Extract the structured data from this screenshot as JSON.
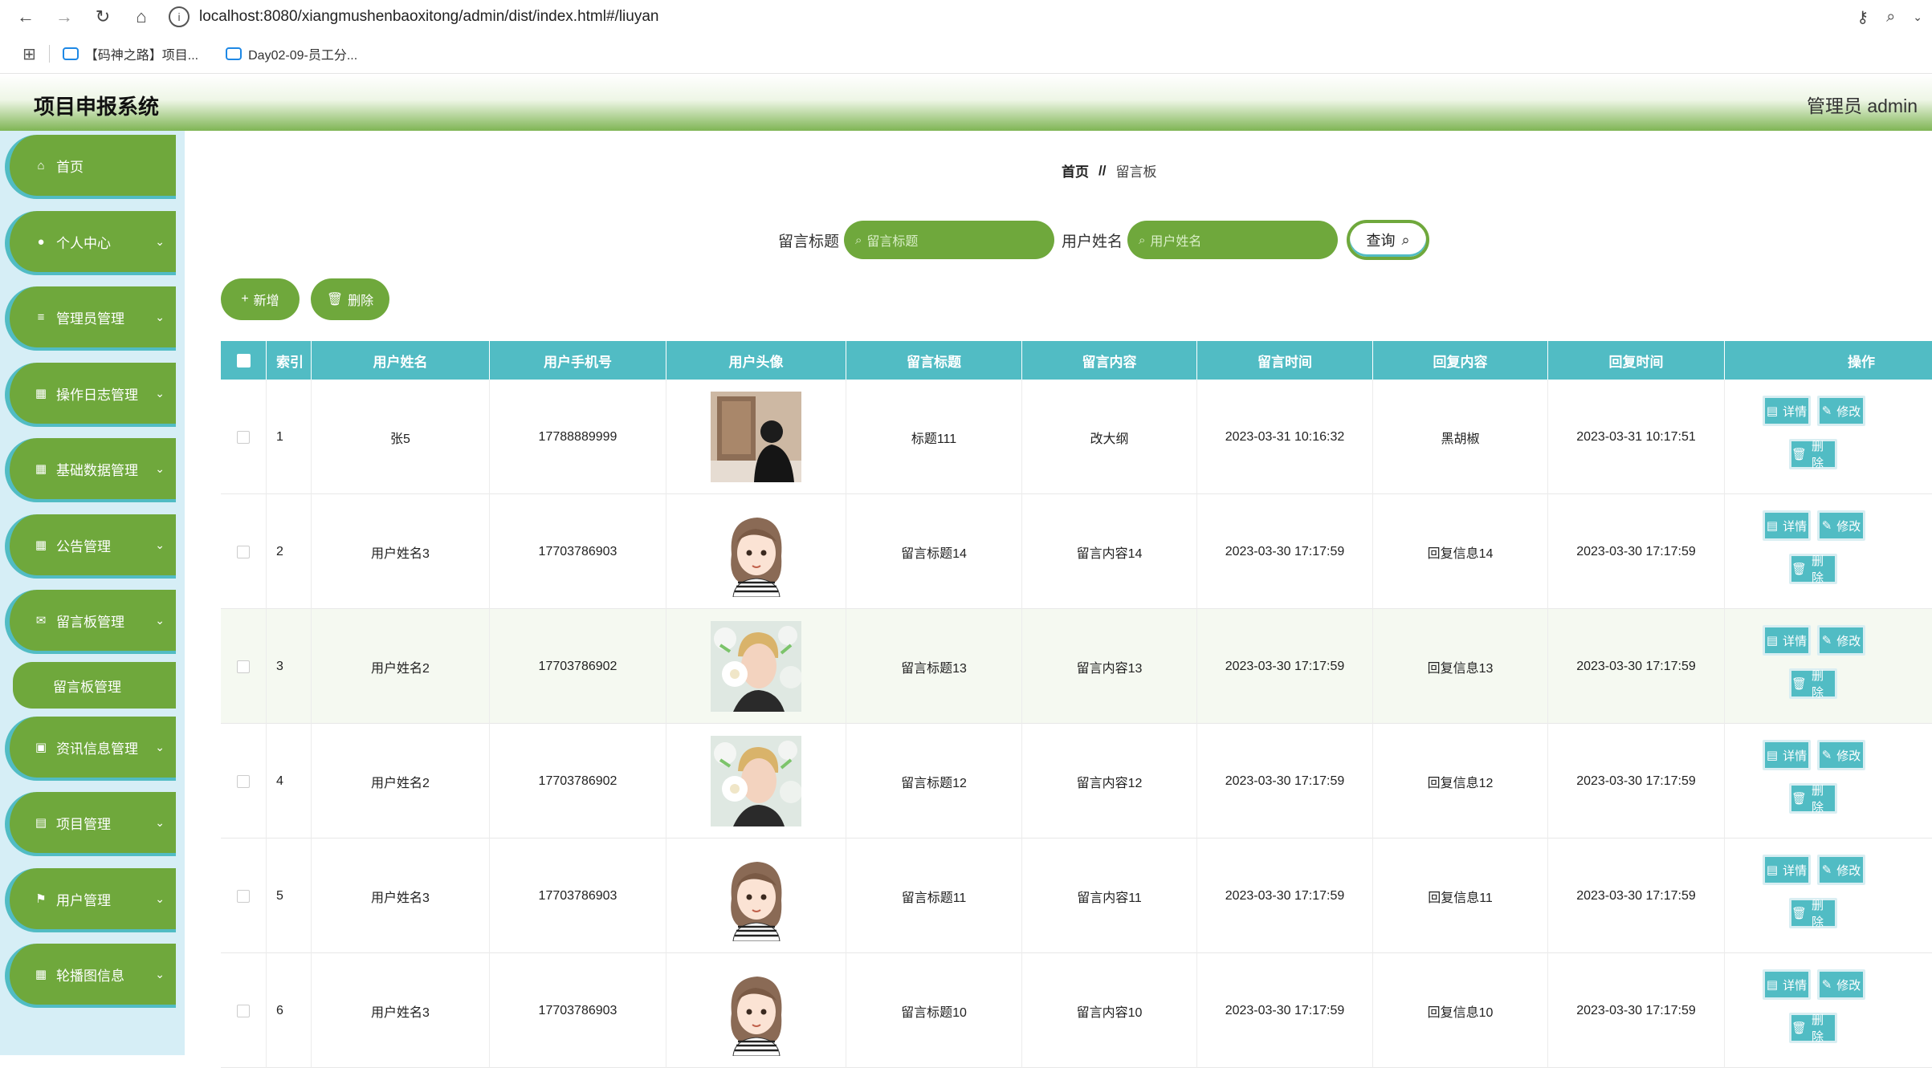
{
  "browser": {
    "url": "localhost:8080/xiangmushenbaoxitong/admin/dist/index.html#/liuyan",
    "bookmarks": [
      "【码神之路】项目...",
      "Day02-09-员工分..."
    ]
  },
  "header": {
    "title": "项目申报系统",
    "user": "管理员 admin"
  },
  "sidebar": {
    "items": [
      {
        "label": "首页",
        "icon": "home-icon",
        "has_submenu": false
      },
      {
        "label": "个人中心",
        "icon": "user-icon",
        "has_submenu": true
      },
      {
        "label": "管理员管理",
        "icon": "list-icon",
        "has_submenu": true
      },
      {
        "label": "操作日志管理",
        "icon": "grid-icon",
        "has_submenu": true
      },
      {
        "label": "基础数据管理",
        "icon": "grid-icon",
        "has_submenu": true
      },
      {
        "label": "公告管理",
        "icon": "grid-icon",
        "has_submenu": true
      },
      {
        "label": "留言板管理",
        "icon": "chat-icon",
        "has_submenu": true
      },
      {
        "label": "资讯信息管理",
        "icon": "news-icon",
        "has_submenu": true
      },
      {
        "label": "项目管理",
        "icon": "project-icon",
        "has_submenu": true
      },
      {
        "label": "用户管理",
        "icon": "flag-icon",
        "has_submenu": true
      },
      {
        "label": "轮播图信息",
        "icon": "grid-icon",
        "has_submenu": true
      }
    ],
    "active_subitem": "留言板管理"
  },
  "breadcrumb": {
    "home": "首页",
    "separator": "//",
    "current": "留言板"
  },
  "search": {
    "title_label": "留言标题",
    "title_placeholder": "留言标题",
    "name_label": "用户姓名",
    "name_placeholder": "用户姓名",
    "query_button": "查询"
  },
  "actions": {
    "add": "新增",
    "delete": "删除"
  },
  "table": {
    "columns": [
      "索引",
      "用户姓名",
      "用户手机号",
      "用户头像",
      "留言标题",
      "留言内容",
      "留言时间",
      "回复内容",
      "回复时间",
      "操作"
    ],
    "rows": [
      {
        "index": "1",
        "name": "张5",
        "phone": "17788889999",
        "avatar": "photo-back",
        "title": "标题111",
        "content": "改大纲",
        "time": "2023-03-31 10:16:32",
        "reply": "黑胡椒",
        "reply_time": "2023-03-31 10:17:51"
      },
      {
        "index": "2",
        "name": "用户姓名3",
        "phone": "17703786903",
        "avatar": "cartoon-girl",
        "title": "留言标题14",
        "content": "留言内容14",
        "time": "2023-03-30 17:17:59",
        "reply": "回复信息14",
        "reply_time": "2023-03-30 17:17:59"
      },
      {
        "index": "3",
        "name": "用户姓名2",
        "phone": "17703786902",
        "avatar": "flower-boy",
        "title": "留言标题13",
        "content": "留言内容13",
        "time": "2023-03-30 17:17:59",
        "reply": "回复信息13",
        "reply_time": "2023-03-30 17:17:59"
      },
      {
        "index": "4",
        "name": "用户姓名2",
        "phone": "17703786902",
        "avatar": "flower-boy",
        "title": "留言标题12",
        "content": "留言内容12",
        "time": "2023-03-30 17:17:59",
        "reply": "回复信息12",
        "reply_time": "2023-03-30 17:17:59"
      },
      {
        "index": "5",
        "name": "用户姓名3",
        "phone": "17703786903",
        "avatar": "cartoon-girl",
        "title": "留言标题11",
        "content": "留言内容11",
        "time": "2023-03-30 17:17:59",
        "reply": "回复信息11",
        "reply_time": "2023-03-30 17:17:59"
      },
      {
        "index": "6",
        "name": "用户姓名3",
        "phone": "17703786903",
        "avatar": "cartoon-girl",
        "title": "留言标题10",
        "content": "留言内容10",
        "time": "2023-03-30 17:17:59",
        "reply": "回复信息10",
        "reply_time": "2023-03-30 17:17:59"
      }
    ],
    "row_actions": {
      "detail": "详情",
      "edit": "修改",
      "delete": "删除"
    }
  },
  "colors": {
    "green": "#6fa83c",
    "teal": "#51bcc4",
    "sidebar_bg": "#d6eef6"
  }
}
